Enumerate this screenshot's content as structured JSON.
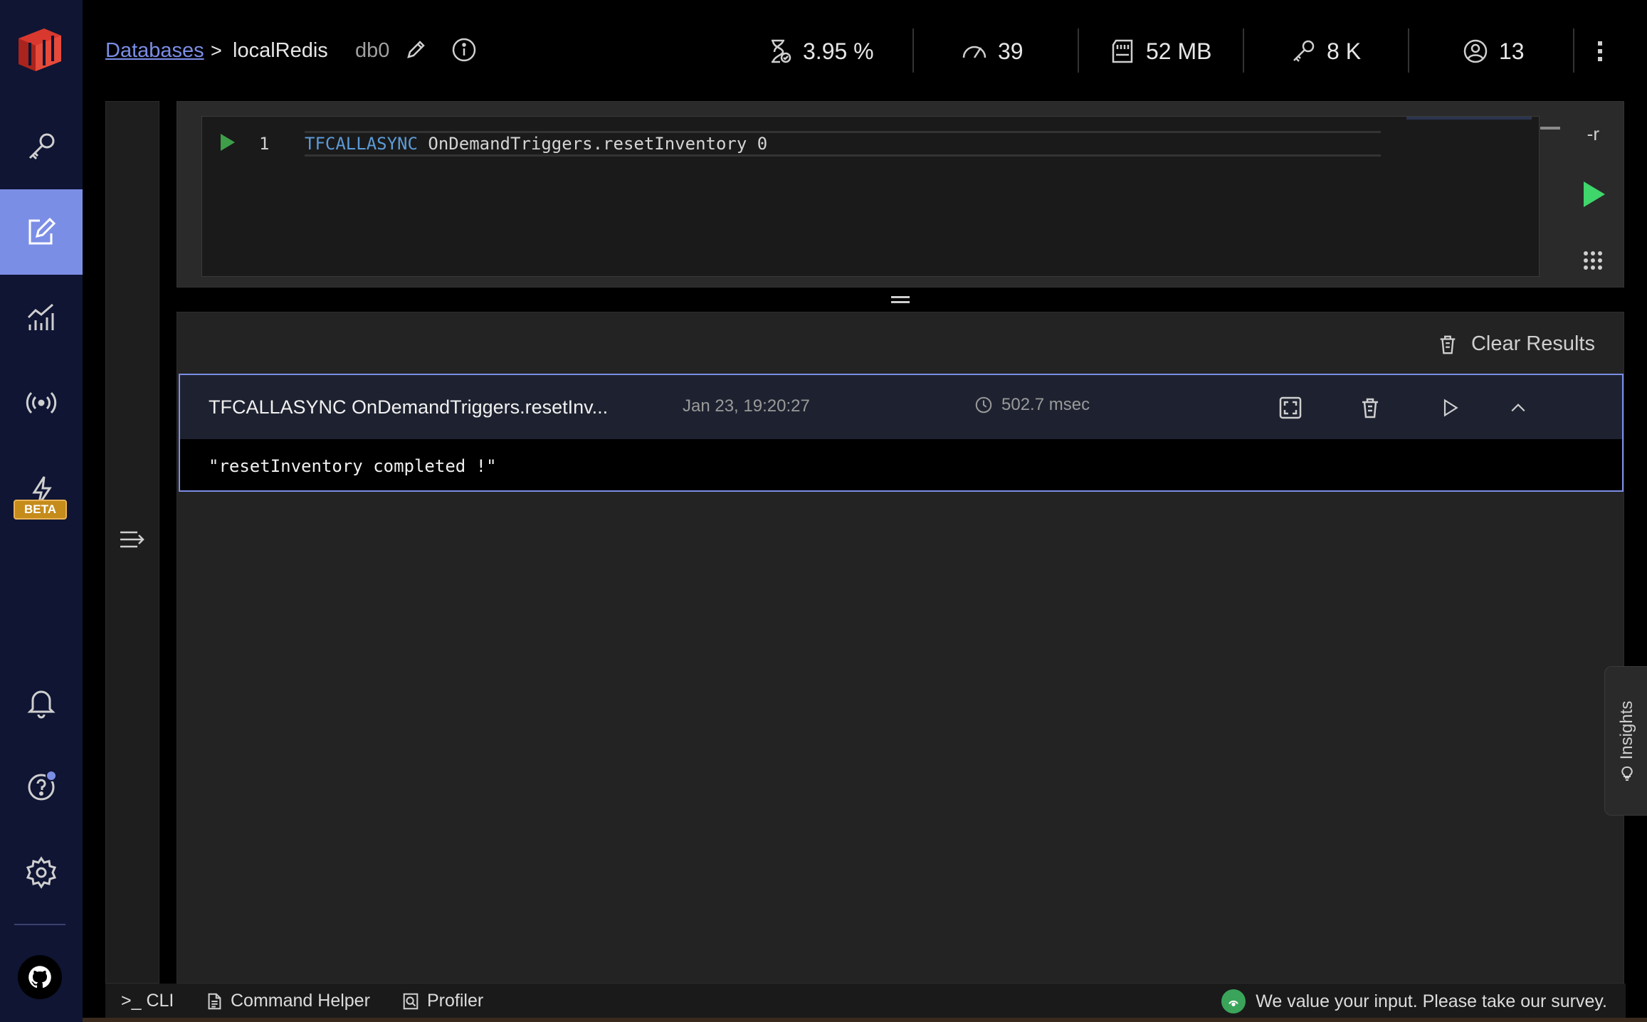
{
  "sidebar": {
    "items": [
      {
        "name": "browser",
        "icon": "key-icon"
      },
      {
        "name": "workbench",
        "icon": "edit-icon",
        "active": true
      },
      {
        "name": "analytics",
        "icon": "chart-icon"
      },
      {
        "name": "pubsub",
        "icon": "broadcast-icon"
      },
      {
        "name": "triggers",
        "icon": "lightning-icon",
        "badge": "BETA"
      },
      {
        "name": "notifications",
        "icon": "bell-icon"
      },
      {
        "name": "help",
        "icon": "help-icon"
      },
      {
        "name": "settings",
        "icon": "gear-icon"
      },
      {
        "name": "github",
        "icon": "github-icon"
      }
    ],
    "beta_label": "BETA"
  },
  "header": {
    "breadcrumb_link": "Databases",
    "breadcrumb_sep": ">",
    "db_name": "localRedis",
    "db_index": "db0",
    "stats": {
      "cpu": "3.95 %",
      "ops": "39",
      "memory": "52 MB",
      "keys": "8 K",
      "clients": "13"
    }
  },
  "editor": {
    "line_number": "1",
    "keyword": "TFCALLASYNC",
    "code_rest": " OnDemandTriggers.resetInventory 0",
    "flag": "-r"
  },
  "results": {
    "clear_label": "Clear Results",
    "items": [
      {
        "command": "TFCALLASYNC OnDemandTriggers.resetInv...",
        "timestamp": "Jan 23, 19:20:27",
        "duration": "502.7 msec",
        "output": "\"resetInventory completed !\""
      }
    ]
  },
  "insights_label": "Insights",
  "footer": {
    "cli_label": ">_ CLI",
    "command_helper_label": "Command Helper",
    "profiler_label": "Profiler",
    "survey_text": "We value your input. Please take our survey."
  },
  "colors": {
    "accent": "#7b8ee6",
    "sidebar_bg": "#0f1533",
    "run_green": "#3fd66b",
    "beta": "#c58b1b"
  }
}
